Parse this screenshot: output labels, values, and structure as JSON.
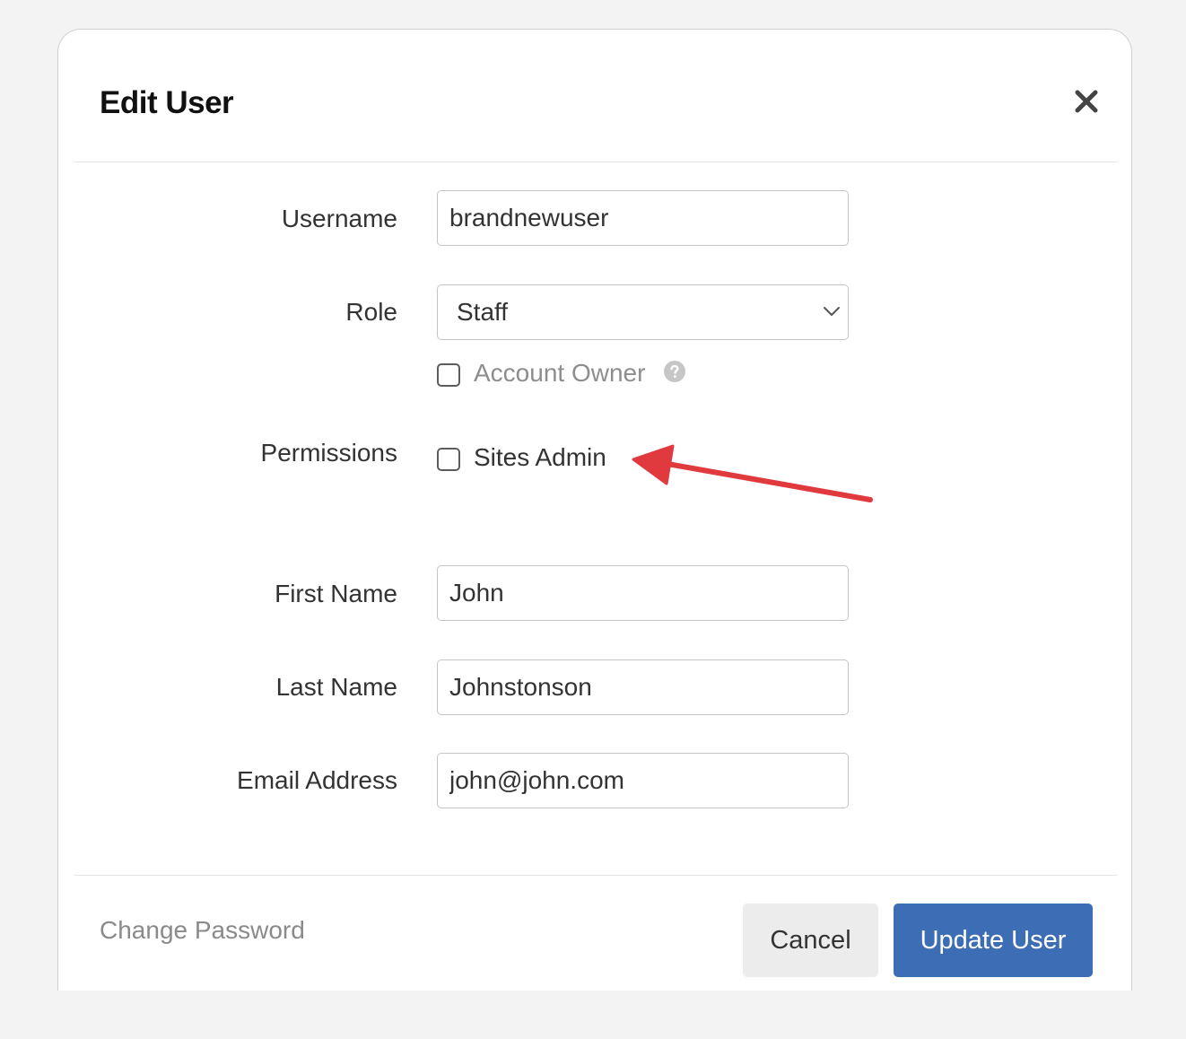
{
  "dialog": {
    "title": "Edit User",
    "close_symbol": "close-icon"
  },
  "form": {
    "username": {
      "label": "Username",
      "value": "brandnewuser"
    },
    "role": {
      "label": "Role",
      "value": "Staff"
    },
    "account_owner": {
      "label": "Account Owner",
      "checked": false
    },
    "permissions": {
      "label": "Permissions",
      "sites_admin": {
        "label": "Sites Admin",
        "checked": false
      }
    },
    "first_name": {
      "label": "First Name",
      "value": "John"
    },
    "last_name": {
      "label": "Last Name",
      "value": "Johnstonson"
    },
    "email": {
      "label": "Email Address",
      "value": "john@john.com"
    }
  },
  "footer": {
    "change_password": "Change Password",
    "cancel": "Cancel",
    "update": "Update User"
  },
  "annotation": {
    "arrow_icon": "arrow-icon",
    "arrow_color": "#e0393e"
  },
  "colors": {
    "primary": "#3d6eb5",
    "cancel_bg": "#ececec",
    "muted_text": "#8a8a8a"
  }
}
